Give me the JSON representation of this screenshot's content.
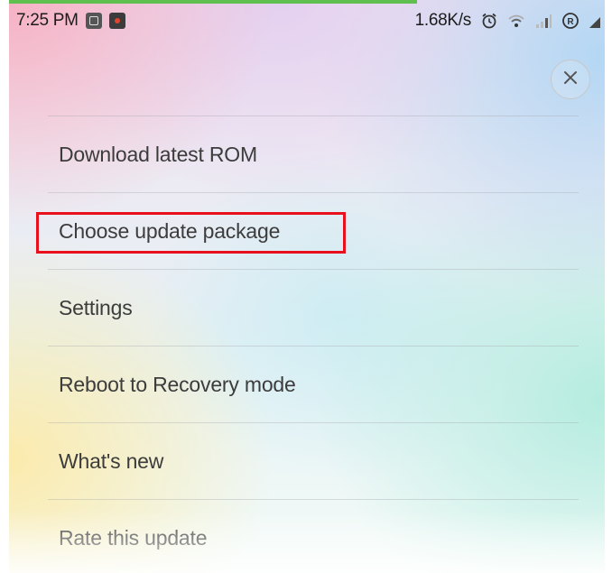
{
  "status_bar": {
    "time": "7:25 PM",
    "notifications": [
      "gallery-icon",
      "screen-record-icon"
    ],
    "network_speed": "1.68K/s",
    "icons": [
      "alarm-icon",
      "wifi-icon",
      "signal-icon",
      "roaming-icon",
      "signal-icon"
    ]
  },
  "close_button": {
    "icon": "close-icon"
  },
  "menu": {
    "items": [
      {
        "label": "Download latest ROM"
      },
      {
        "label": "Choose update package",
        "highlighted": true
      },
      {
        "label": "Settings"
      },
      {
        "label": "Reboot to Recovery mode"
      },
      {
        "label": "What's new"
      },
      {
        "label": "Rate this update"
      }
    ]
  },
  "colors": {
    "highlight": "#e8101c",
    "progress": "#5fbf4f",
    "text": "#3c3c3c"
  }
}
